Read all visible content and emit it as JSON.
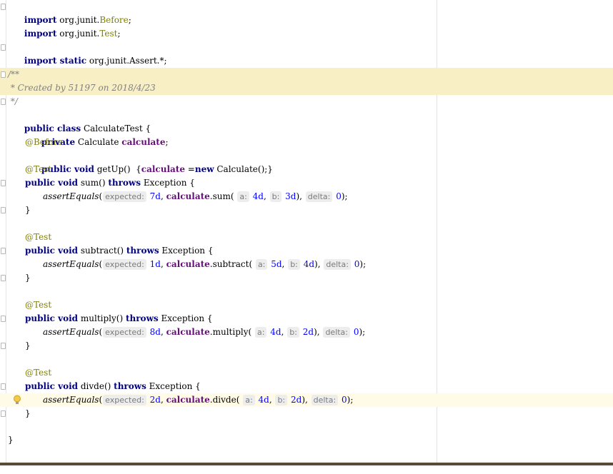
{
  "editor": {
    "imports": {
      "kw": "import",
      "before_pkg": "org.junit.",
      "before_cls": "Before",
      "test_pkg": "org.junit.",
      "test_cls": "Test",
      "static_kw": "import static",
      "assert_pkg": "org.junit.Assert.*;"
    },
    "doc": {
      "open": "/**",
      "line": " * Created by 51197 on 2018/4/23",
      "close": " */"
    },
    "class_decl": {
      "kw": "public class",
      "name": " CalculateTest {"
    },
    "field": {
      "kw": "private",
      "type": " Calculate ",
      "name": "calculate",
      "end": ";"
    },
    "annotations": {
      "before": "@Before",
      "test": "@Test"
    },
    "setup": {
      "kw": "public void",
      "sig": " getUp()  {",
      "field": "calculate",
      "op": " =",
      "new_kw": "new",
      "rest": " Calculate();}"
    },
    "keywords": {
      "public_void": "public void",
      "throws": "throws",
      "exception": " Exception {",
      "close_brace": "}"
    },
    "hints": {
      "expected": "expected:",
      "a": "a:",
      "b": "b:",
      "delta": "delta:"
    },
    "tests": [
      {
        "method": "sum",
        "expected": "7d",
        "a": "4d",
        "b": "3d",
        "delta": "0"
      },
      {
        "method": "subtract",
        "expected": "1d",
        "a": "5d",
        "b": "4d",
        "delta": "0"
      },
      {
        "method": "multiply",
        "expected": "8d",
        "a": "4d",
        "b": "2d",
        "delta": "0"
      },
      {
        "method": "divde",
        "expected": "2d",
        "a": "4d",
        "b": "2d",
        "delta": "0"
      }
    ],
    "assert_fn": "assertEquals",
    "final_brace": "}",
    "colors": {
      "keyword": "#000080",
      "annotation": "#808000",
      "comment": "#808080",
      "field": "#660e7a",
      "number": "#0000ff",
      "doc_highlight": "#f8f0c4",
      "current_line": "#fffbe6"
    }
  }
}
